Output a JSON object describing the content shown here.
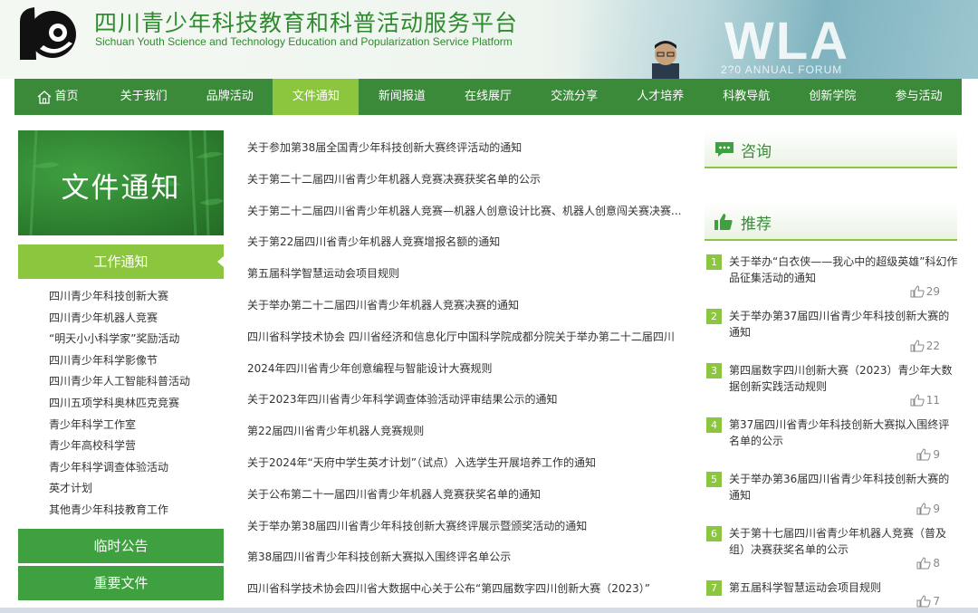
{
  "header": {
    "title": "四川青少年科技教育和科普活动服务平台",
    "subtitle": "Sichuan Youth Science and Technology Education and Popularization Service Platform",
    "banner_text": "WLA",
    "banner_forum": "2?0 ANNUAL FORUM"
  },
  "nav": {
    "items": [
      {
        "label": "首页",
        "icon": "home-icon"
      },
      {
        "label": "关于我们"
      },
      {
        "label": "品牌活动"
      },
      {
        "label": "文件通知",
        "active": true
      },
      {
        "label": "新闻报道"
      },
      {
        "label": "在线展厅"
      },
      {
        "label": "交流分享"
      },
      {
        "label": "人才培养"
      },
      {
        "label": "科教导航"
      },
      {
        "label": "创新学院"
      },
      {
        "label": "参与活动"
      }
    ],
    "active_color": "#8cc63e",
    "bg_color": "#3a8a3a"
  },
  "sidebar": {
    "banner_title": "文件通知",
    "section_title": "工作通知",
    "links": [
      "四川青少年科技创新大赛",
      "四川青少年机器人竞赛",
      "“明天小小科学家”奖励活动",
      "四川青少年科学影像节",
      "四川青少年人工智能科普活动",
      "四川五项学科奥林匹克竞赛",
      "青少年科学工作室",
      "青少年高校科学营",
      "青少年科学调查体验活动",
      "英才计划",
      "其他青少年科技教育工作"
    ],
    "buttons": [
      "临时公告",
      "重要文件"
    ]
  },
  "main": {
    "items": [
      "关于参加第38届全国青少年科技创新大赛终评活动的通知",
      "关于第二十二届四川省青少年机器人竞赛决赛获奖名单的公示",
      "关于第二十二届四川省青少年机器人竞赛—机器人创意设计比赛、机器人创意闯关赛决赛...",
      "关于第22届四川省青少年机器人竞赛增报名额的通知",
      "第五届科学智慧运动会项目规则",
      "关于举办第二十二届四川省青少年机器人竞赛决赛的通知",
      "四川省科学技术协会 四川省经济和信息化厅中国科学院成都分院关于举办第二十二届四川",
      "2024年四川省青少年创意编程与智能设计大赛规则",
      "关于2023年四川省青少年科学调查体验活动评审结果公示的通知",
      "第22届四川省青少年机器人竞赛规则",
      "关于2024年“天府中学生英才计划”（试点）入选学生开展培养工作的通知",
      "关于公布第二十一届四川省青少年机器人竞赛获奖名单的通知",
      "关于举办第38届四川省青少年科技创新大赛终评展示暨颁奖活动的通知",
      "第38届四川省青少年科技创新大赛拟入围终评名单公示",
      "四川省科学技术协会四川省大数据中心关于公布“第四届数字四川创新大赛（2023）”"
    ]
  },
  "right": {
    "consult_title": "咨询",
    "recommend_title": "推荐",
    "recommend": [
      {
        "num": "1",
        "title": "关于举办“白衣侠——我心中的超级英雄”科幻作品征集活动的通知",
        "likes": "29"
      },
      {
        "num": "2",
        "title": "关于举办第37届四川省青少年科技创新大赛的通知",
        "likes": "22"
      },
      {
        "num": "3",
        "title": "第四届数字四川创新大赛（2023）青少年大数据创新实践活动规则",
        "likes": "11"
      },
      {
        "num": "4",
        "title": "第37届四川省青少年科技创新大赛拟入围终评名单的公示",
        "likes": "9"
      },
      {
        "num": "5",
        "title": "关于举办第36届四川省青少年科技创新大赛的通知",
        "likes": "9"
      },
      {
        "num": "6",
        "title": "关于第十七届四川省青少年机器人竞赛（普及组）决赛获奖名单的公示",
        "likes": "8"
      },
      {
        "num": "7",
        "title": "第五届科学智慧运动会项目规则",
        "likes": "7"
      }
    ]
  }
}
